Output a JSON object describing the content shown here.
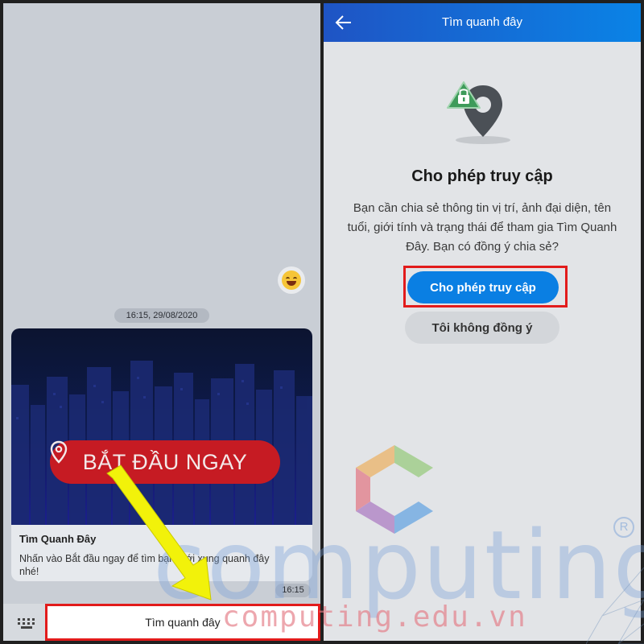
{
  "left_screen": {
    "timestamp_pill": "16:15, 29/08/2020",
    "card": {
      "banner_cta": "BẮT ĐẦU NGAY",
      "title": "Tìm Quanh Đây",
      "description": "Nhấn vào Bắt đầu ngay để tìm bạn mới xung quanh đây nhé!"
    },
    "message_time": "16:15",
    "quick_reply": "Tìm quanh đây",
    "icons": [
      "emoji-icon",
      "keyboard-icon",
      "location-pin-icon"
    ]
  },
  "right_screen": {
    "header": {
      "title": "Tìm quanh đây",
      "back_icon": "arrow-left-icon"
    },
    "permission": {
      "title": "Cho phép truy cập",
      "body": "Bạn cần chia sẻ thông tin vị trí, ảnh đại diện, tên tuổi, giới tính và trạng thái để tham gia Tìm Quanh Đây. Bạn có đồng ý chia sẻ?",
      "allow_button": "Cho phép truy cập",
      "deny_button": "Tôi không đồng ý"
    }
  },
  "watermark": {
    "word": "computing",
    "registered": "R",
    "url": "computing.edu.vn"
  },
  "colors": {
    "header_gradient_start": "#1f54c4",
    "header_gradient_end": "#0a83e6",
    "primary_button": "#0a7fe3",
    "highlight_frame": "#e21b1b",
    "cta_red": "#c61b23",
    "arrow_yellow": "#f2f20a"
  }
}
